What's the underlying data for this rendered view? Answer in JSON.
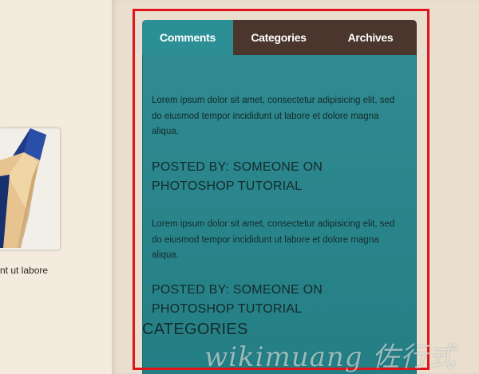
{
  "left_column": {
    "caption": "nt ut labore",
    "thumbnail": "pencil-image"
  },
  "widget": {
    "tabs": [
      {
        "label": "Comments",
        "active": true
      },
      {
        "label": "Categories",
        "active": false
      },
      {
        "label": "Archives",
        "active": false
      }
    ],
    "posts": [
      {
        "text": "Lorem ipsum dolor sit amet, consectetur adipisicing elit, sed do eiusmod tempor incididunt ut labore et dolore magna aliqua.",
        "posted_line1": "POSTED BY: SOMEONE ON",
        "posted_line2": "PHOTOSHOP TUTORIAL"
      },
      {
        "text": "Lorem ipsum dolor sit amet, consectetur adipisicing elit, sed do eiusmod tempor incididunt ut labore et dolore magna aliqua.",
        "posted_line1": "POSTED BY: SOMEONE ON",
        "posted_line2": "PHOTOSHOP TUTORIAL"
      }
    ],
    "section_heading": "CATEGORIES"
  },
  "watermark": "wikimuang 佐行式",
  "colors": {
    "tab_bar": "#4a362c",
    "active_tab": "#2c8f95",
    "panel": "#2a868c",
    "highlight": "#e1141b",
    "page_bg": "#f3eadc"
  }
}
